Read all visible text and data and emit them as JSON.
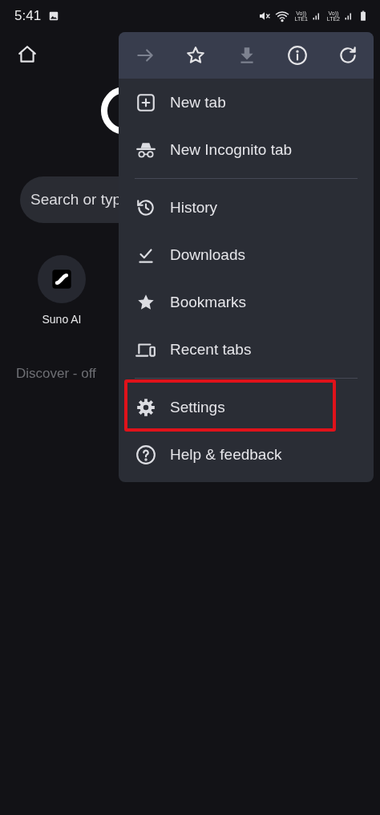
{
  "status_bar": {
    "time": "5:41",
    "sims": [
      {
        "top": "Vo))",
        "bottom": "LTE1"
      },
      {
        "top": "Vo))",
        "bottom": "LTE2"
      }
    ]
  },
  "home": {
    "search": {
      "placeholder": "Search or typ"
    },
    "shortcuts": [
      {
        "label": "Suno AI"
      }
    ],
    "discover": "Discover - off"
  },
  "menu": {
    "toolbar": [
      {
        "kind": "forward",
        "disabled": true
      },
      {
        "kind": "star",
        "disabled": false
      },
      {
        "kind": "download",
        "disabled": true
      },
      {
        "kind": "info",
        "disabled": false
      },
      {
        "kind": "refresh",
        "disabled": false
      }
    ],
    "items": [
      {
        "kind": "newtab",
        "label": "New tab",
        "highlighted": false,
        "divider_after": false
      },
      {
        "kind": "incognito",
        "label": "New Incognito tab",
        "highlighted": false,
        "divider_after": true
      },
      {
        "kind": "history",
        "label": "History",
        "highlighted": false,
        "divider_after": false
      },
      {
        "kind": "downloads",
        "label": "Downloads",
        "highlighted": false,
        "divider_after": false
      },
      {
        "kind": "bookmarks",
        "label": "Bookmarks",
        "highlighted": false,
        "divider_after": false
      },
      {
        "kind": "recent",
        "label": "Recent tabs",
        "highlighted": false,
        "divider_after": true
      },
      {
        "kind": "settings",
        "label": "Settings",
        "highlighted": true,
        "divider_after": false
      },
      {
        "kind": "help",
        "label": "Help & feedback",
        "highlighted": false,
        "divider_after": false
      }
    ]
  }
}
